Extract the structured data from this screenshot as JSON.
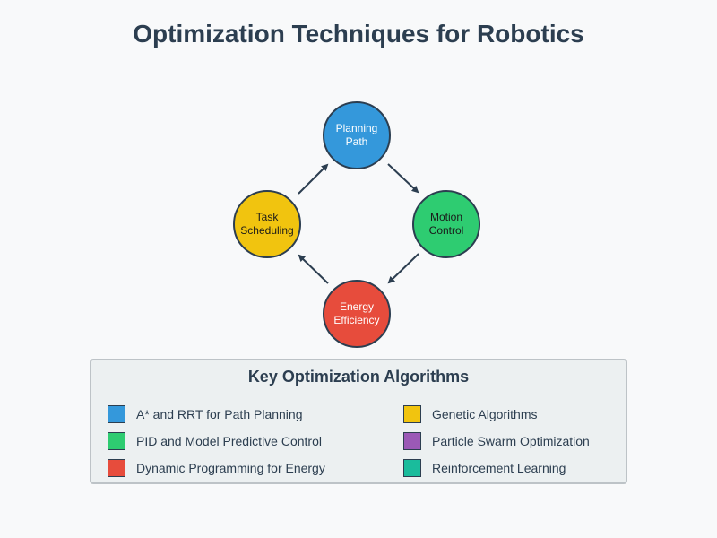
{
  "title": "Optimization Techniques for Robotics",
  "cycle": {
    "nodes": [
      {
        "label": "Planning\nPath",
        "color": "#3498db"
      },
      {
        "label": "Motion\nControl",
        "color": "#2ecc71"
      },
      {
        "label": "Energy\nEfficiency",
        "color": "#e74c3c"
      },
      {
        "label": "Task\nScheduling",
        "color": "#f1c40f"
      }
    ],
    "arrow_color": "#2c3e50"
  },
  "legend": {
    "title": "Key Optimization Algorithms",
    "items": [
      {
        "label": "A* and RRT for Path Planning",
        "color": "#3498db"
      },
      {
        "label": "PID and Model Predictive Control",
        "color": "#2ecc71"
      },
      {
        "label": "Dynamic Programming for Energy",
        "color": "#e74c3c"
      },
      {
        "label": "Genetic Algorithms",
        "color": "#f1c40f"
      },
      {
        "label": "Particle Swarm Optimization",
        "color": "#9b59b6"
      },
      {
        "label": "Reinforcement Learning",
        "color": "#1abc9c"
      }
    ]
  }
}
